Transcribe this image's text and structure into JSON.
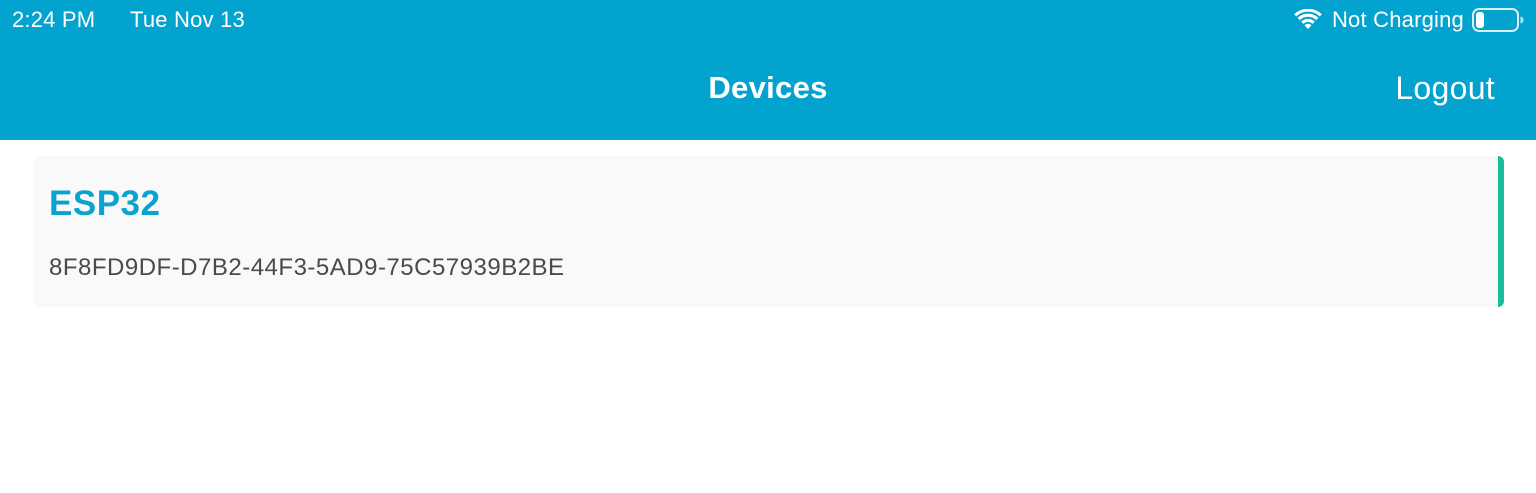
{
  "status_bar": {
    "time": "2:24 PM",
    "date": "Tue Nov 13",
    "charging_text": "Not Charging",
    "wifi_icon": "wifi-icon",
    "battery_icon": "battery-icon"
  },
  "nav": {
    "title": "Devices",
    "logout_label": "Logout"
  },
  "devices": [
    {
      "name": "ESP32",
      "id": "8F8FD9DF-D7B2-44F3-5AD9-75C57939B2BE"
    }
  ],
  "colors": {
    "header_bg": "#02A4CF",
    "device_name": "#0AA3CF",
    "card_bg": "#F9F9F9",
    "card_accent": "#1BBC9B",
    "device_id_text": "#4A4A4A"
  }
}
